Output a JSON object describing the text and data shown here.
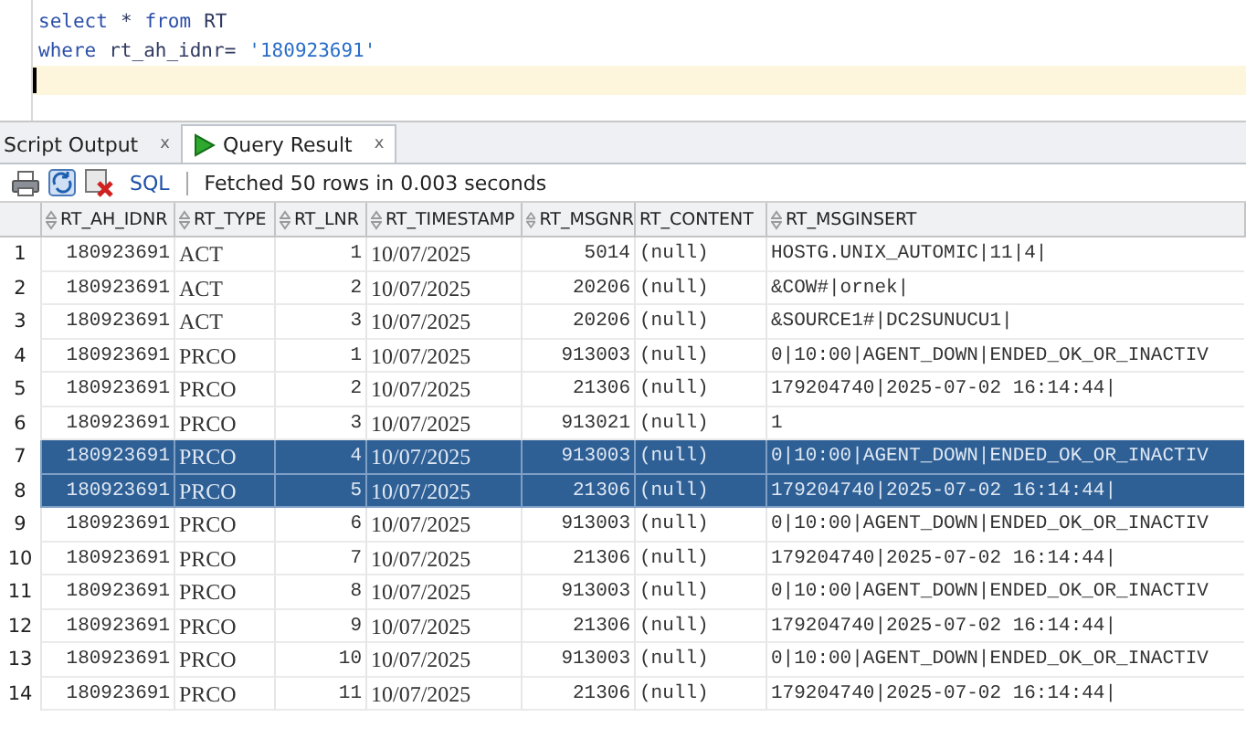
{
  "editor": {
    "lines": [
      {
        "tokens": [
          {
            "kind": "keyword",
            "text": "select"
          },
          {
            "kind": "plain",
            "text": "*"
          },
          {
            "kind": "keyword",
            "text": "from"
          },
          {
            "kind": "plain",
            "text": "RT"
          }
        ]
      },
      {
        "tokens": [
          {
            "kind": "keyword",
            "text": "where"
          },
          {
            "kind": "plain",
            "text": "rt_ah_idnr="
          },
          {
            "kind": "string",
            "text": "'180923691'"
          }
        ]
      }
    ]
  },
  "tabs": [
    {
      "label": "Script Output",
      "selected": false,
      "close": "x"
    },
    {
      "label": "Query Result",
      "selected": true,
      "close": "x"
    }
  ],
  "toolbar": {
    "sql_link": "SQL",
    "status": "Fetched 50 rows in 0.003 seconds"
  },
  "table": {
    "columns": [
      {
        "label": "RT_AH_IDNR",
        "sortable": true
      },
      {
        "label": "RT_TYPE",
        "sortable": true
      },
      {
        "label": "RT_LNR",
        "sortable": true
      },
      {
        "label": "RT_TIMESTAMP",
        "sortable": true
      },
      {
        "label": "RT_MSGNR",
        "sortable": true
      },
      {
        "label": "RT_CONTENT",
        "sortable": false
      },
      {
        "label": "RT_MSGINSERT",
        "sortable": true
      }
    ],
    "rows": [
      {
        "num": "1",
        "selected": false,
        "cells": [
          "180923691",
          "ACT",
          "1",
          "10/07/2025",
          "5014",
          "(null)",
          "HOSTG.UNIX_AUTOMIC|11|4|"
        ]
      },
      {
        "num": "2",
        "selected": false,
        "cells": [
          "180923691",
          "ACT",
          "2",
          "10/07/2025",
          "20206",
          "(null)",
          "&COW#|ornek|"
        ]
      },
      {
        "num": "3",
        "selected": false,
        "cells": [
          "180923691",
          "ACT",
          "3",
          "10/07/2025",
          "20206",
          "(null)",
          "&SOURCE1#|DC2SUNUCU1|"
        ]
      },
      {
        "num": "4",
        "selected": false,
        "cells": [
          "180923691",
          "PRCO",
          "1",
          "10/07/2025",
          "913003",
          "(null)",
          "0|10:00|AGENT_DOWN|ENDED_OK_OR_INACTIV"
        ]
      },
      {
        "num": "5",
        "selected": false,
        "cells": [
          "180923691",
          "PRCO",
          "2",
          "10/07/2025",
          "21306",
          "(null)",
          "179204740|2025-07-02 16:14:44|"
        ]
      },
      {
        "num": "6",
        "selected": false,
        "cells": [
          "180923691",
          "PRCO",
          "3",
          "10/07/2025",
          "913021",
          "(null)",
          "1"
        ]
      },
      {
        "num": "7",
        "selected": true,
        "cells": [
          "180923691",
          "PRCO",
          "4",
          "10/07/2025",
          "913003",
          "(null)",
          "0|10:00|AGENT_DOWN|ENDED_OK_OR_INACTIV"
        ]
      },
      {
        "num": "8",
        "selected": true,
        "cells": [
          "180923691",
          "PRCO",
          "5",
          "10/07/2025",
          "21306",
          "(null)",
          "179204740|2025-07-02 16:14:44|"
        ]
      },
      {
        "num": "9",
        "selected": false,
        "cells": [
          "180923691",
          "PRCO",
          "6",
          "10/07/2025",
          "913003",
          "(null)",
          "0|10:00|AGENT_DOWN|ENDED_OK_OR_INACTIV"
        ]
      },
      {
        "num": "10",
        "selected": false,
        "cells": [
          "180923691",
          "PRCO",
          "7",
          "10/07/2025",
          "21306",
          "(null)",
          "179204740|2025-07-02 16:14:44|"
        ]
      },
      {
        "num": "11",
        "selected": false,
        "cells": [
          "180923691",
          "PRCO",
          "8",
          "10/07/2025",
          "913003",
          "(null)",
          "0|10:00|AGENT_DOWN|ENDED_OK_OR_INACTIV"
        ]
      },
      {
        "num": "12",
        "selected": false,
        "cells": [
          "180923691",
          "PRCO",
          "9",
          "10/07/2025",
          "21306",
          "(null)",
          "179204740|2025-07-02 16:14:44|"
        ]
      },
      {
        "num": "13",
        "selected": false,
        "cells": [
          "180923691",
          "PRCO",
          "10",
          "10/07/2025",
          "913003",
          "(null)",
          "0|10:00|AGENT_DOWN|ENDED_OK_OR_INACTIV"
        ]
      },
      {
        "num": "14",
        "selected": false,
        "cells": [
          "180923691",
          "PRCO",
          "11",
          "10/07/2025",
          "21306",
          "(null)",
          "179204740|2025-07-02 16:14:44|"
        ]
      }
    ]
  }
}
